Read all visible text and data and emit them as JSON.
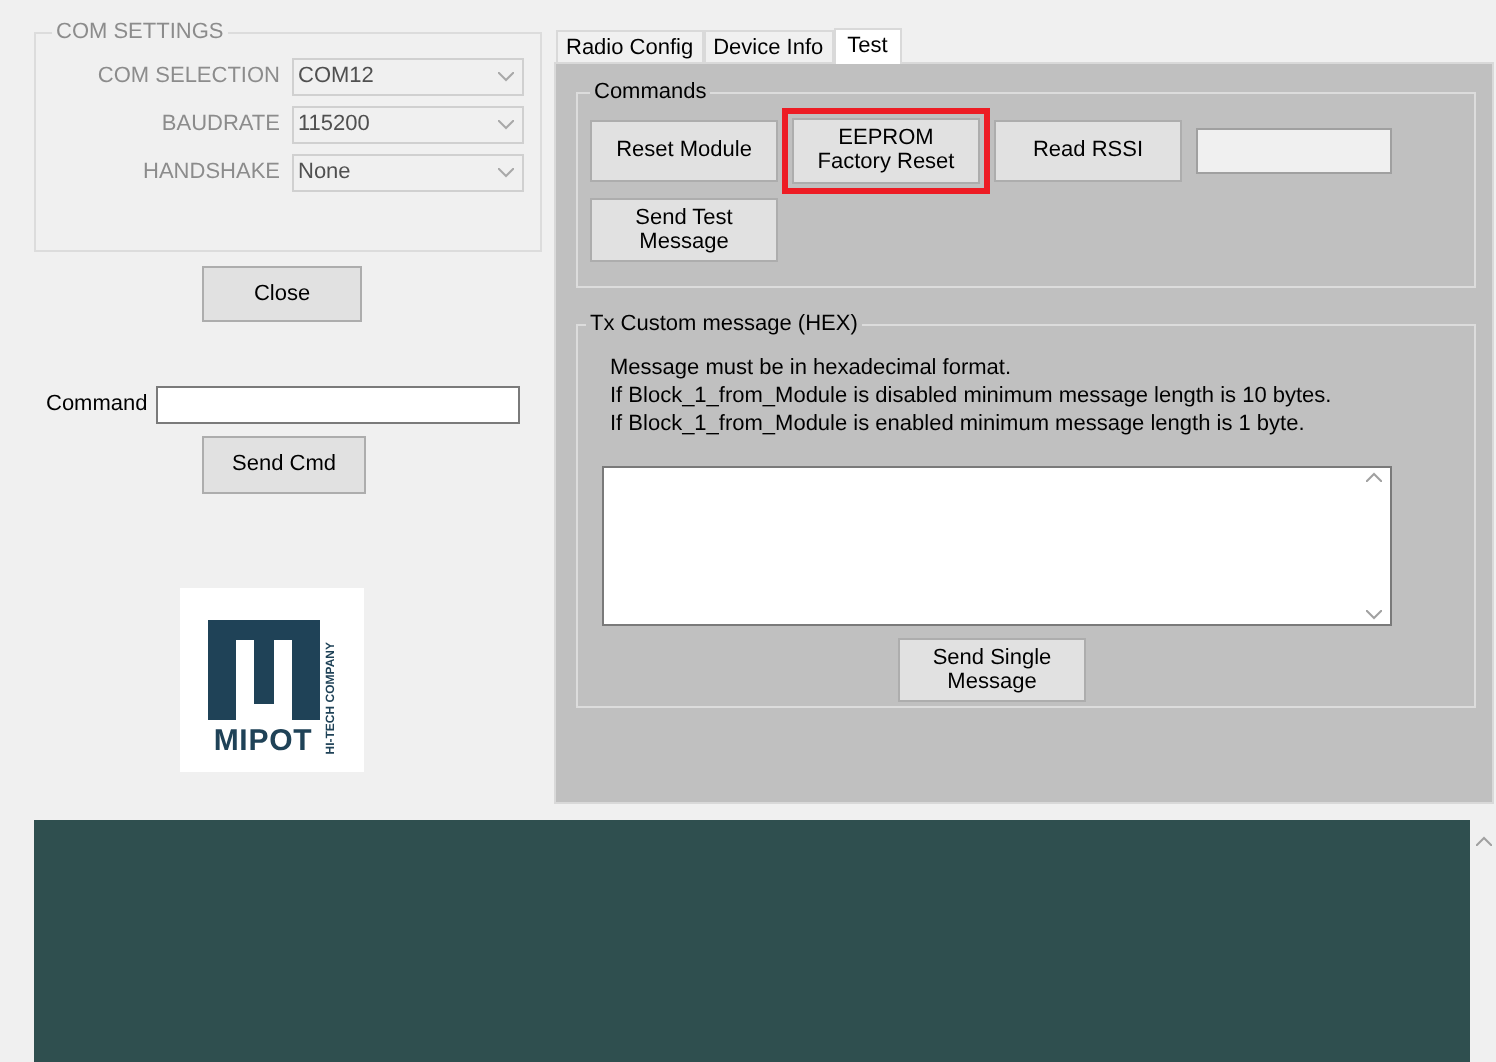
{
  "com_settings": {
    "title": "COM SETTINGS",
    "disabled": true,
    "fields": [
      {
        "label": "COM SELECTION",
        "value": "COM12"
      },
      {
        "label": "BAUDRATE",
        "value": "115200"
      },
      {
        "label": "HANDSHAKE",
        "value": "None"
      }
    ]
  },
  "close_button": "Close",
  "command": {
    "label": "Command"
  },
  "send_cmd_button": "Send Cmd",
  "logo": {
    "name": "MIPOT",
    "tagline": "HI-TECH COMPANY"
  },
  "tabs": [
    {
      "label": "Radio Config",
      "selected": false
    },
    {
      "label": "Device Info",
      "selected": false
    },
    {
      "label": "Test",
      "selected": true
    }
  ],
  "commands": {
    "title": "Commands",
    "buttons": [
      {
        "label": "Reset Module",
        "highlighted": false
      },
      {
        "label": "EEPROM Factory Reset",
        "highlighted": true
      },
      {
        "label": "Read RSSI",
        "highlighted": false
      }
    ],
    "send_test_button": "Send Test Message"
  },
  "tx_custom": {
    "title": "Tx Custom message (HEX)",
    "notes": [
      "Message must be in hexadecimal format.",
      "If Block_1_from_Module is disabled minimum message length is 10 bytes.",
      "If Block_1_from_Module is enabled minimum message length is 1 byte."
    ],
    "send_button": "Send Single Message"
  }
}
